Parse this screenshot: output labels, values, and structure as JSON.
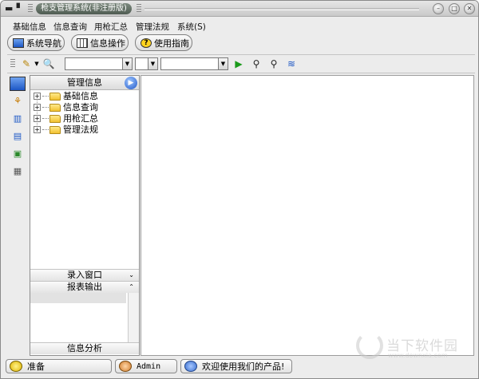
{
  "window": {
    "title": "枪支管理系统(非注册版)"
  },
  "menubar": {
    "items": [
      "基础信息",
      "信息查询",
      "用枪汇总",
      "管理法规",
      "系统(S)"
    ]
  },
  "navbar": {
    "buttons": [
      {
        "label": "系统导航",
        "icon": "monitor-icon"
      },
      {
        "label": "信息操作",
        "icon": "table-icon"
      },
      {
        "label": "使用指南",
        "icon": "help-icon"
      }
    ]
  },
  "toolbar": {
    "combo1_value": "",
    "combo2_value": "",
    "combo3_value": ""
  },
  "left_pane": {
    "header": "管理信息",
    "tree": [
      "基础信息",
      "信息查询",
      "用枪汇总",
      "管理法规"
    ],
    "sections": [
      "录入窗口",
      "报表输出",
      "信息分析"
    ]
  },
  "statusbar": {
    "status": "准备",
    "user": "Admin",
    "message": "欢迎使用我们的产品!"
  },
  "watermark": {
    "text": "当下软件园",
    "url": "www.downxia.com"
  },
  "colors": {
    "accent": "#1f56c8",
    "window_bg": "#ececec",
    "title_pill": "#5d6a60"
  }
}
